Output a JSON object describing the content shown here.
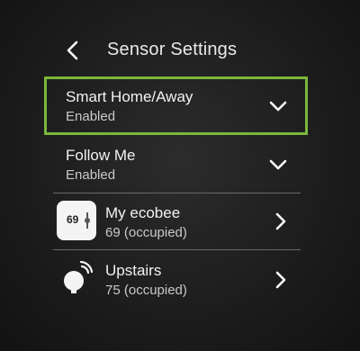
{
  "header": {
    "title": "Sensor Settings",
    "back_icon": "chevron-left-icon"
  },
  "settings": [
    {
      "label": "Smart Home/Away",
      "value": "Enabled",
      "icon": "chevron-down-icon",
      "focused": true
    },
    {
      "label": "Follow Me",
      "value": "Enabled",
      "icon": "chevron-down-icon",
      "focused": false
    }
  ],
  "sensors": [
    {
      "label": "My ecobee",
      "status": "69 (occupied)",
      "tile_text": "69",
      "icon": "thermostat-icon",
      "action_icon": "chevron-right-icon"
    },
    {
      "label": "Upstairs",
      "status": "75 (occupied)",
      "icon": "room-sensor-icon",
      "action_icon": "chevron-right-icon"
    }
  ],
  "colors": {
    "focus": "#7ab83a",
    "background": "#1c1c1c",
    "text": "#f2f2f2",
    "subtext": "#c9c9c9",
    "divider": "#6a6a6a"
  }
}
